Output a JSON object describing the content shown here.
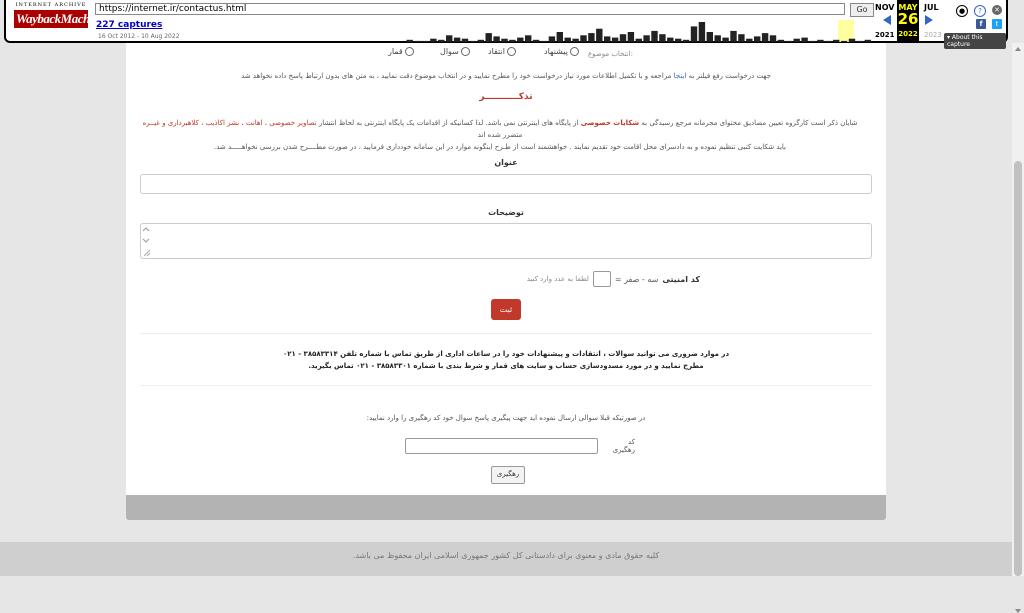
{
  "wayback": {
    "logo_top": "INTERNET ARCHIVE",
    "logo_main": "WaybackMachine",
    "url": "https://internet.ir/contactus.html",
    "go_label": "Go",
    "captures": "227 captures",
    "range": "16 Oct 2012 - 10 Aug 2022",
    "prev_month": "NOV",
    "cur_month": "MAY",
    "next_month": "JUL",
    "cur_day": "26",
    "prev_year": "2021",
    "cur_year": "2022",
    "next_year": "2023",
    "about": "▾ About this capture",
    "spark_values": [
      2,
      1,
      1,
      3,
      2,
      6,
      4,
      3,
      1,
      2,
      8,
      5,
      3,
      2,
      4,
      6,
      2,
      1,
      5,
      9,
      4,
      3,
      6,
      8,
      12,
      5,
      4,
      7,
      9,
      3,
      6,
      10,
      7,
      4,
      3,
      2,
      14,
      18,
      9,
      6,
      4,
      10,
      7,
      3,
      5,
      8,
      6,
      2,
      1,
      3,
      4,
      1,
      2,
      1,
      2,
      1,
      3,
      1,
      2
    ]
  },
  "form": {
    "topic_label": "انتخاب موضوع",
    "topics": [
      "پیشنهاد",
      "انتقاد",
      "سوال",
      "قمار"
    ],
    "intro_pre": "جهت درخواست رفع فیلتر به",
    "intro_link": "اینجا",
    "intro_post": "مراجعه و با تکمیل اطلاعات مورد نیاز درخواست خود را مطرح نمایید و در انتخاب موضوع دقت نمایید ، به متن های بدون ارتباط پاسخ داده نخواهد شد",
    "reminder": "تذکـــــــــــر",
    "notice_1a": "شایان ذکر است کارگروه تعیین مصادیق محتوای مجرمانه مرجع رسیدگی به",
    "notice_1b": "شکایات خصوصی",
    "notice_1c": "از پایگاه های اینترنتی نمی باشد. لذا کسانیکه از اقدامات یک پایگاه اینترنتی به لحاظ انتشار",
    "notice_1d": "تصاویر خصوصی ، اهانت ، نشر اکاذیب ، کلاهبرداری و غیــره",
    "notice_1e": "متضرر شده اند",
    "notice_2": "باید شکایت کتبی تنظیم نموده و به دادسرای محل اقامت خود تقدیم نمایند . خواهشمند است از طـرح اینگونه موارد در این سامانه خودداری فرمایید ، در صورت مطــــرح شدن بررسی نخواهـــــد شد.",
    "title_label": "عنوان",
    "desc_label": "توضیحات",
    "captcha_label": "کد امنیتی",
    "captcha_question": "سه - صفر =",
    "captcha_hint": "لطفا به عدد وارد کنید",
    "submit_label": "ثبت",
    "contact_1": "در موارد ضروری می توانید سوالات ، انتقادات و پیشنهادات خود را در ساعات اداری از طریق تماس با شماره تلفن ۳۸۵۸۳۳۱۴ - ۰۲۱",
    "contact_2": "مطرح نمایید و در مورد مسدودسازی حساب و سایت های قمار و شرط بندی با شماره ۳۸۵۸۳۳۰۱ - ۰۲۱ تماس بگیرید.",
    "track_intro": "در صورتیکه قبلا سوالی ارسال نموده اید جهت پیگیری پاسخ سوال خود کد رهگیری را وارد نمایید:",
    "track_label": "کد رهگیری",
    "track_button": "رهگیری"
  },
  "footer": {
    "text": "کلیه حقوق مادی و معنوی برای دادستانی کل کشور جمهوری اسلامی ایران محفوظ می باشد."
  }
}
